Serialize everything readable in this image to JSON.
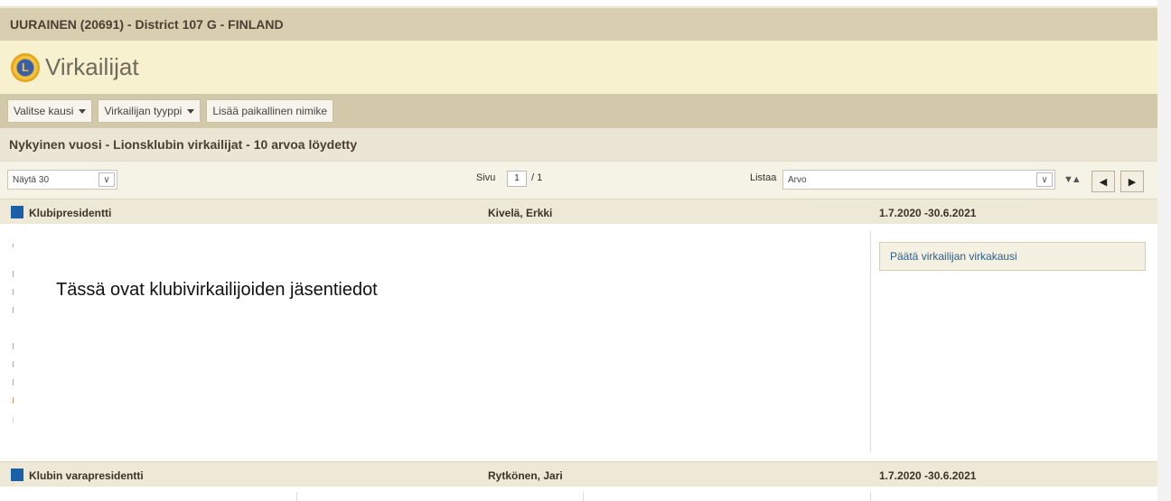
{
  "header": {
    "club": "UURAINEN (20691) - District 107 G - FINLAND"
  },
  "title": {
    "text": "Virkailijat",
    "logo_icon": "lions-logo"
  },
  "toolbar": {
    "season_label": "Valitse kausi",
    "officer_type_label": "Virkailijan tyyppi",
    "add_local_title_label": "Lisää paikallinen nimike"
  },
  "subheader": {
    "text": "Nykyinen vuosi - Lionsklubin virkailijat - 10 arvoa löydetty"
  },
  "controls": {
    "show_value": "Näytä 30",
    "page_label": "Sivu",
    "page_number": "1",
    "page_total": "/ 1",
    "list_label": "Listaa",
    "list_value": "Arvo"
  },
  "officers": [
    {
      "role": "Klubipresidentti",
      "name": "Kivelä, Erkki",
      "dates": "1.7.2020 -30.6.2021"
    },
    {
      "role": "Klubin varapresidentti",
      "name": "Rytkönen, Jari",
      "dates": "1.7.2020 -30.6.2021"
    }
  ],
  "detail": {
    "note": "Tässä ovat klubivirkailijoiden jäsentiedot",
    "end_term_action": "Päätä virkailijan virkakausi"
  },
  "colors": {
    "accent_square": "#1a5fa8",
    "header_bg": "#d8ceb0",
    "title_bg": "#f7f1cf"
  }
}
